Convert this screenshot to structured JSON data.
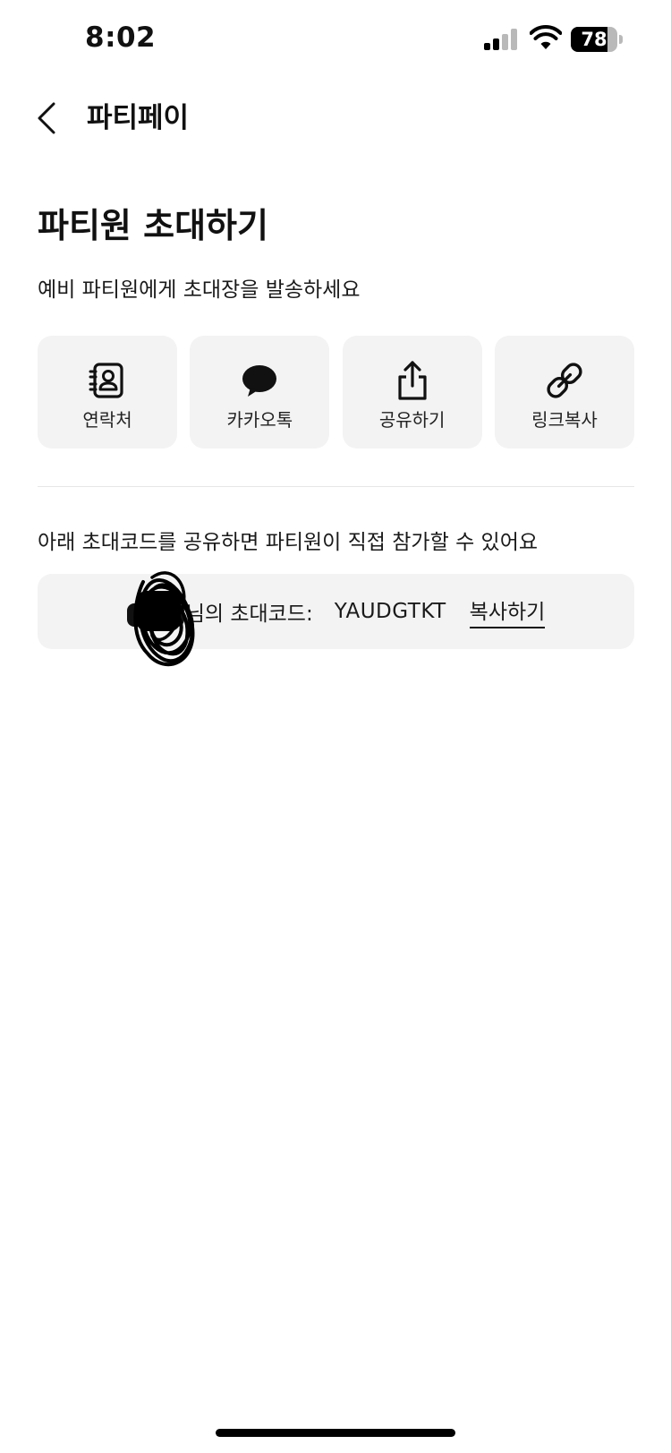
{
  "status_bar": {
    "time": "8:02",
    "battery_level": "78",
    "battery_fraction": 0.78,
    "signal_icon": "cellular-signal-icon",
    "wifi_icon": "wifi-icon"
  },
  "header": {
    "back_icon": "chevron-left-icon",
    "title": "파티페이"
  },
  "main": {
    "title": "파티원 초대하기",
    "subtitle": "예비 파티원에게 초대장을 발송하세요",
    "share_options": [
      {
        "label": "연락처",
        "icon": "contacts-icon"
      },
      {
        "label": "카카오톡",
        "icon": "speech-bubble-icon"
      },
      {
        "label": "공유하기",
        "icon": "share-icon"
      },
      {
        "label": "링크복사",
        "icon": "link-icon"
      }
    ],
    "invite_description": "아래 초대코드를 공유하면 파티원이 직접 참가할 수 있어요",
    "invite_code": {
      "owner_label": "님의 초대코드:",
      "code": "YAUDGTKT",
      "copy_label": "복사하기"
    }
  },
  "colors": {
    "background": "#ffffff",
    "card_background": "#f3f3f3",
    "text": "#111111",
    "divider": "#e6e6e6"
  }
}
